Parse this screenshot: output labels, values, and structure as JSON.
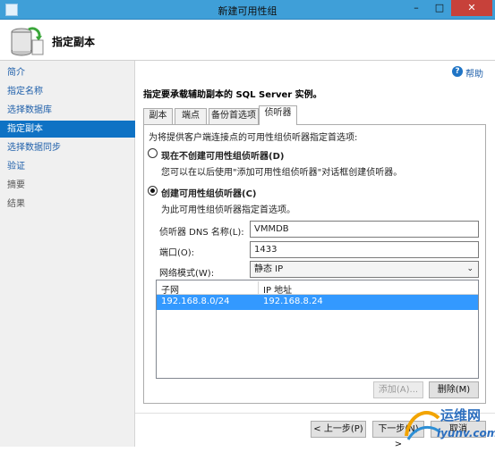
{
  "window": {
    "title": "新建可用性组",
    "min": "–",
    "max": "□",
    "close": "✕"
  },
  "header": {
    "title": "指定副本"
  },
  "sidebar": {
    "items": [
      {
        "label": "简介"
      },
      {
        "label": "指定名称"
      },
      {
        "label": "选择数据库"
      },
      {
        "label": "指定副本"
      },
      {
        "label": "选择数据同步"
      },
      {
        "label": "验证"
      },
      {
        "label": "摘要"
      },
      {
        "label": "结果"
      }
    ]
  },
  "help": {
    "icon": "?",
    "label": "帮助"
  },
  "main": {
    "instruction": "指定要承载辅助副本的 SQL Server 实例。",
    "tabs": [
      {
        "label": "副本"
      },
      {
        "label": "端点"
      },
      {
        "label": "备份首选项"
      },
      {
        "label": "侦听器"
      }
    ],
    "listener": {
      "intro": "为将提供客户端连接点的可用性组侦听器指定首选项:",
      "option_no": {
        "label": "现在不创建可用性组侦听器(D)",
        "desc": "您可以在以后使用\"添加可用性组侦听器\"对话框创建侦听器。"
      },
      "option_yes": {
        "label": "创建可用性组侦听器(C)",
        "desc": "为此可用性组侦听器指定首选项。"
      },
      "dns_label": "侦听器 DNS 名称(L):",
      "dns_value": "VMMDB",
      "port_label": "端口(O):",
      "port_value": "1433",
      "mode_label": "网络模式(W):",
      "mode_value": "静态 IP",
      "grid": {
        "headers": [
          "子网",
          "IP 地址"
        ],
        "rows": [
          [
            "192.168.8.0/24",
            "192.168.8.24"
          ]
        ]
      },
      "add_button": "添加(A)...",
      "remove_button": "删除(M)"
    }
  },
  "footer": {
    "prev_button": "< 上一步(P)",
    "next_button": "下一步(N) >",
    "cancel_button": "取消"
  },
  "watermark": {
    "text": "运维网",
    "url": "iyunv.com"
  }
}
